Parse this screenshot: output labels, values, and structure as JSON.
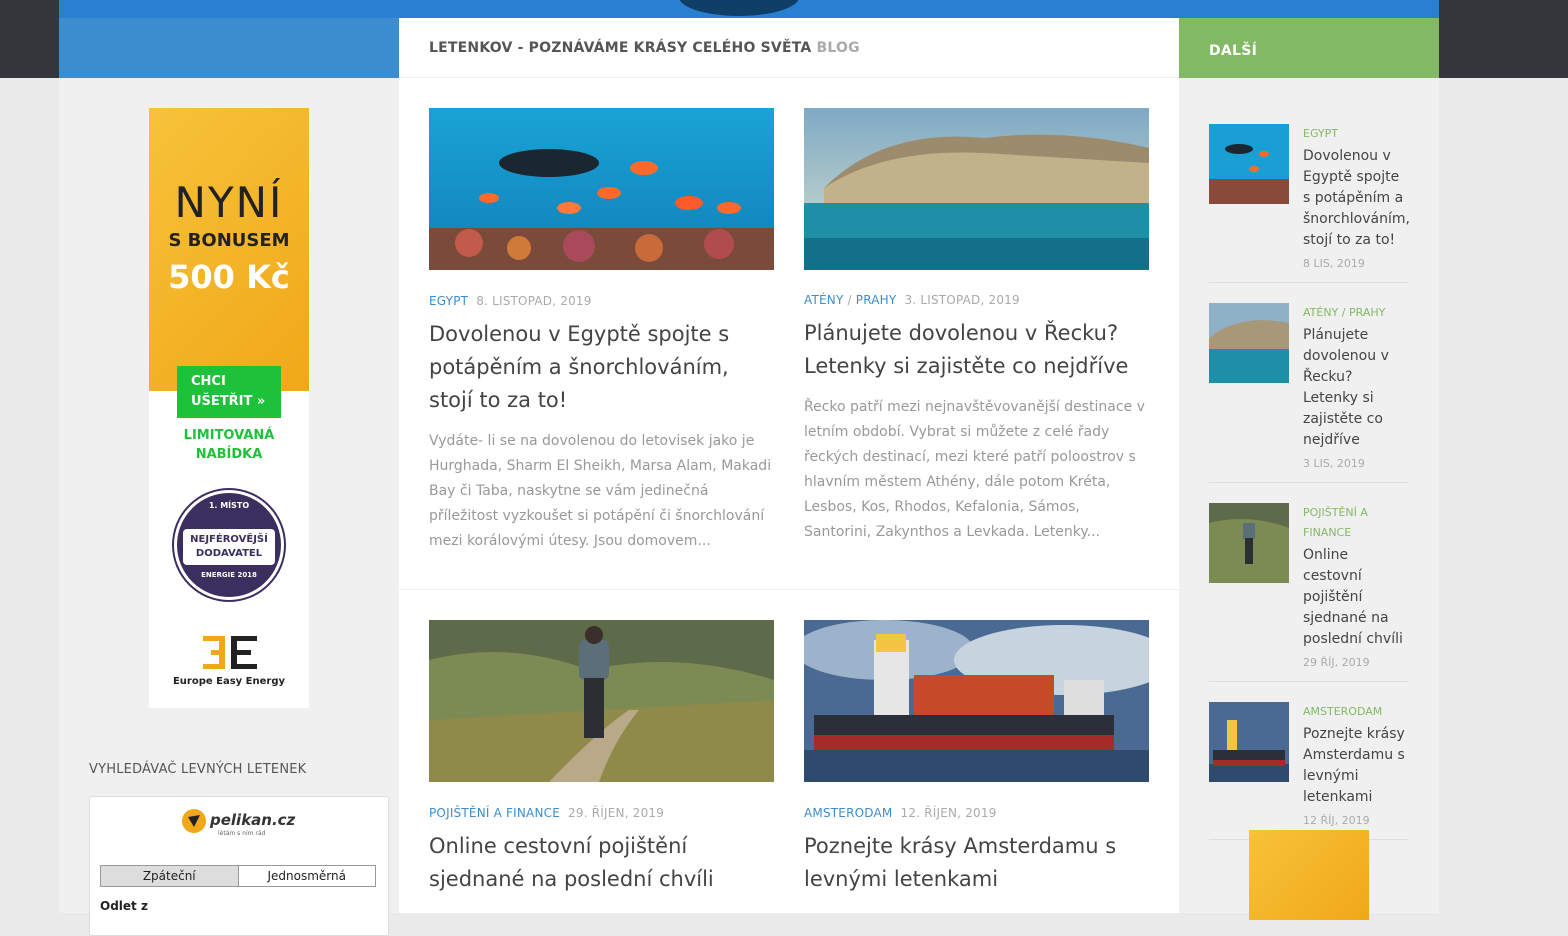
{
  "header": {
    "site_title": "LETENKOV - POZNÁVÁME KRÁSY CELÉHO SVĚTA",
    "tagline": "BLOG",
    "right_label": "DALŠÍ"
  },
  "ad": {
    "line1": "NYNÍ",
    "line2": "S BONUSEM",
    "line3": "500 Kč",
    "button_line1": "CHCI",
    "button_line2": "UŠETŘIT »",
    "limited_line1": "LIMITOVANÁ",
    "limited_line2": "NABÍDKA",
    "badge_top": "1. MÍSTO",
    "badge_mid1": "NEJFÉROVĚJŠÍ",
    "badge_mid2": "DODAVATEL",
    "badge_bottom": "ENERGIE 2018",
    "brand": "Europe Easy Energy"
  },
  "search_widget": {
    "heading": "VYHLEDÁVAČ LEVNÝCH LETENEK",
    "logo_text": "pelikan.cz",
    "logo_sub": "létám s ním rád",
    "tab_round": "Zpáteční",
    "tab_oneway": "Jednosměrná",
    "from_label": "Odlet z"
  },
  "posts": [
    {
      "categories": [
        "EGYPT"
      ],
      "date": "8. LISTOPAD, 2019",
      "title": "Dovolenou v Egyptě spojte s potápěním a šnorchlováním, stojí to za to!",
      "excerpt": "Vydáte- li se na dovolenou do letovisek jako je Hurghada, Sharm El Sheikh, Marsa Alam, Makadi Bay či Taba, naskytne se vám jedinečná příležitost vyzkoušet si potápění či šnorchlování mezi korálovými útesy. Jsou domovem..."
    },
    {
      "categories": [
        "ATÉNY",
        "PRAHY"
      ],
      "date": "3. LISTOPAD, 2019",
      "title": "Plánujete dovolenou v Řecku? Letenky si zajistěte co nejdříve",
      "excerpt": "Řecko patří mezi nejnavštěvovanější destinace v letním období. Vybrat si můžete z celé řady řeckých destinací, mezi které patří poloostrov s hlavním městem Athény, dále potom Kréta, Lesbos, Kos, Rhodos, Kefalonia, Sámos, Santorini, Zakynthos a Levkada. Letenky..."
    },
    {
      "categories": [
        "POJIŠTĚNÍ A FINANCE"
      ],
      "date": "29. ŘÍJEN, 2019",
      "title": "Online cestovní pojištění sjednané na poslední chvíli",
      "excerpt": ""
    },
    {
      "categories": [
        "AMSTERODAM"
      ],
      "date": "12. ŘÍJEN, 2019",
      "title": "Poznejte krásy Amsterdamu s levnými letenkami",
      "excerpt": ""
    }
  ],
  "sidebar_posts": [
    {
      "category": "EGYPT",
      "title": "Dovolenou v Egyptě spojte s potápěním a šnorchlováním, stojí to za to!",
      "date": "8 LIS, 2019"
    },
    {
      "category": "ATÉNY / PRAHY",
      "title": "Plánujete dovolenou v Řecku? Letenky si zajistěte co nejdříve",
      "date": "3 LIS, 2019"
    },
    {
      "category": "POJIŠTĚNÍ A FINANCE",
      "title": "Online cestovní pojištění sjednané na poslední chvíli",
      "date": "29 ŘÍJ, 2019"
    },
    {
      "category": "AMSTERODAM",
      "title": "Poznejte krásy Amsterdamu s levnými letenkami",
      "date": "12 ŘÍJ, 2019"
    }
  ],
  "colors": {
    "accent_blue": "#3b8dd0",
    "accent_green": "#82b965",
    "ad_orange": "#f0a818",
    "cta_green": "#1ec23a"
  }
}
